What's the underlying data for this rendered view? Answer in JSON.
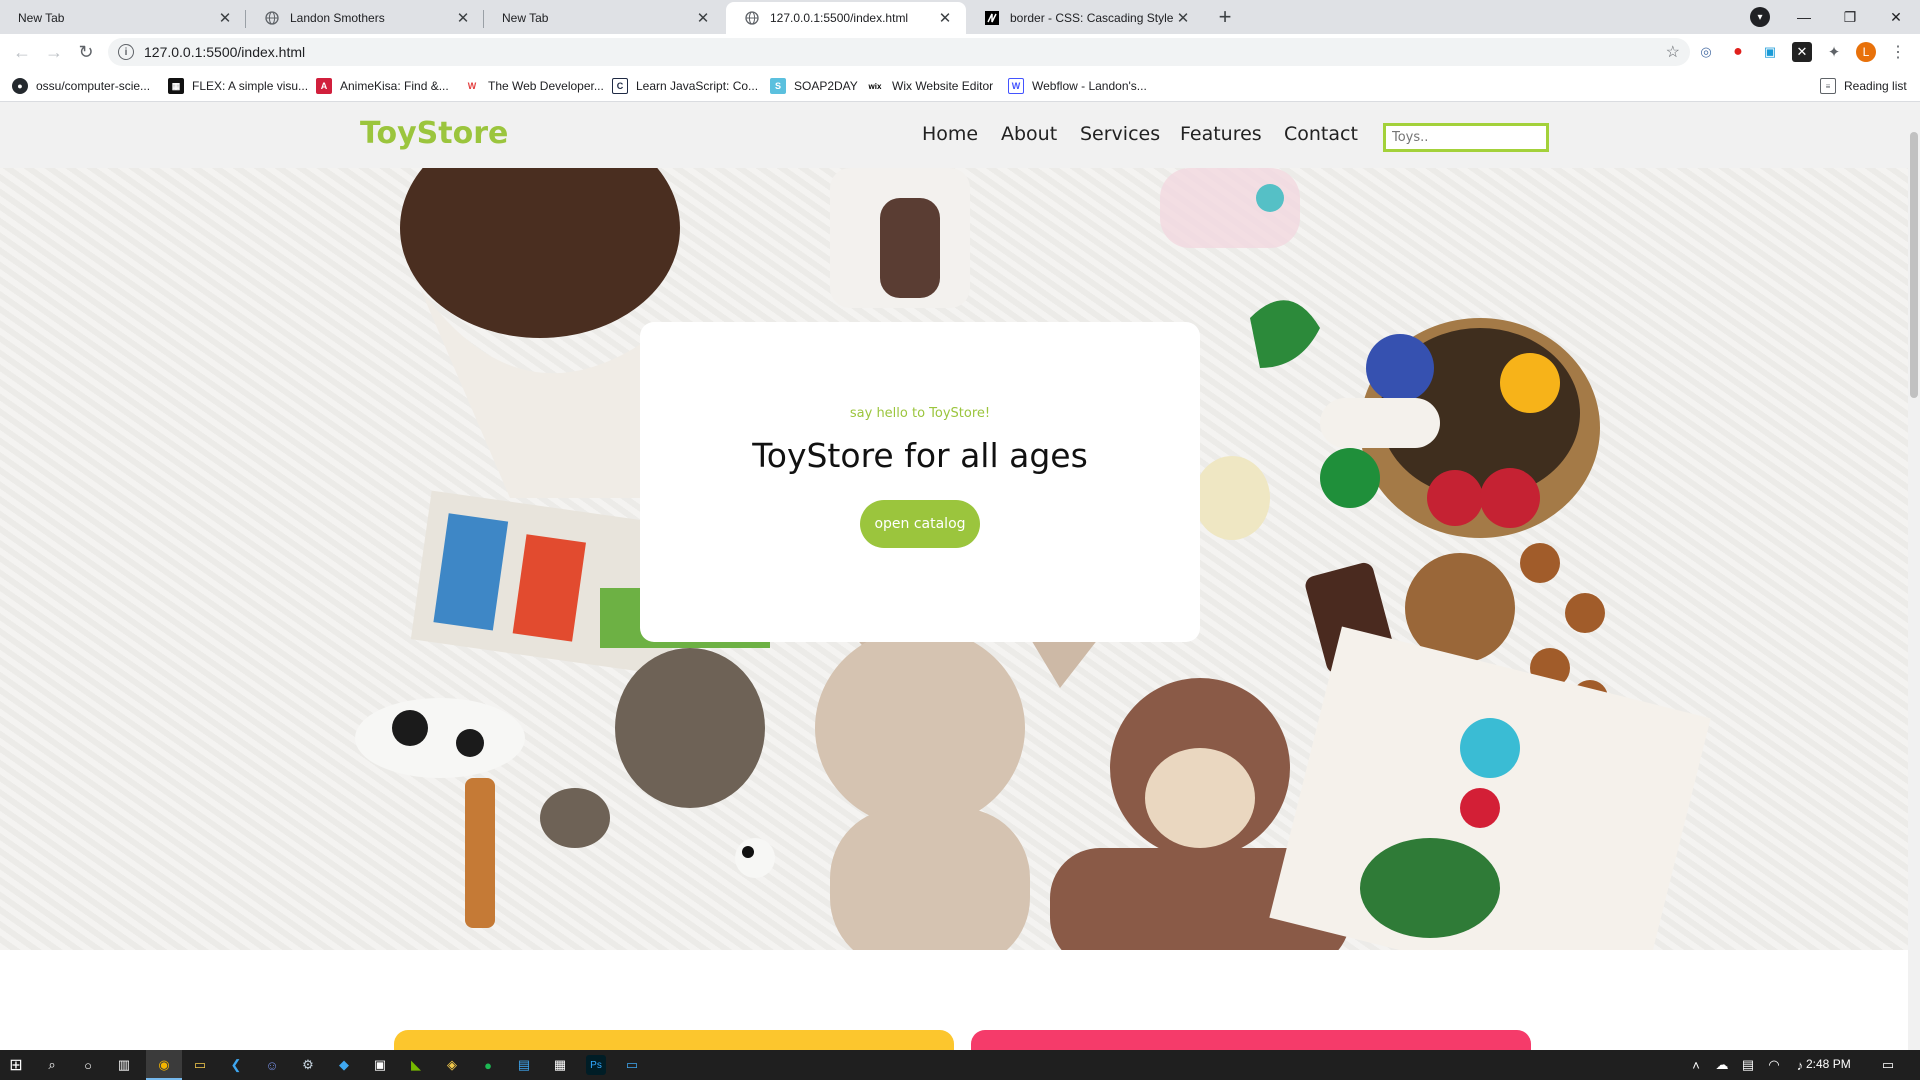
{
  "browser": {
    "tabs": [
      {
        "title": "New Tab",
        "icon": "none",
        "active": false
      },
      {
        "title": "Landon Smothers",
        "icon": "globe-icon",
        "active": false
      },
      {
        "title": "New Tab",
        "icon": "none",
        "active": false
      },
      {
        "title": "127.0.0.1:5500/index.html",
        "icon": "globe-icon",
        "active": true
      },
      {
        "title": "border - CSS: Cascading Style Sh",
        "icon": "mdn-icon",
        "active": false
      }
    ],
    "url": "127.0.0.1:5500/index.html",
    "profile_initial": "L",
    "bookmarks": [
      {
        "label": "ossu/computer-scie...",
        "color": "#24292e",
        "glyph": "●"
      },
      {
        "label": "FLEX: A simple visu...",
        "color": "#111111",
        "glyph": "▦"
      },
      {
        "label": "AnimeKisa: Find &...",
        "color": "#d11f3c",
        "glyph": "A"
      },
      {
        "label": "The Web Developer...",
        "color": "#e33e3e",
        "glyph": "W"
      },
      {
        "label": "Learn JavaScript: Co...",
        "color": "#1f2a44",
        "glyph": "C"
      },
      {
        "label": "SOAP2DAY",
        "color": "#5bc0de",
        "glyph": "S"
      },
      {
        "label": "Wix Website Editor",
        "color": "#ffffff",
        "glyph": "wix"
      },
      {
        "label": "Webflow - Landon's...",
        "color": "#4353ff",
        "glyph": "W"
      }
    ],
    "reading_list": "Reading list"
  },
  "site": {
    "logo": "ToyStore",
    "nav": [
      "Home",
      "About",
      "Services",
      "Features",
      "Contact"
    ],
    "search_placeholder": "Toys..",
    "hero": {
      "tagline": "say hello to ToyStore!",
      "headline": "ToyStore for all ages",
      "cta": "open catalog"
    }
  },
  "taskbar": {
    "time": "2:48 PM"
  },
  "colors": {
    "brand_green": "#9bc53d",
    "card_yellow": "#fcc62d",
    "card_pink": "#f53b6a"
  }
}
